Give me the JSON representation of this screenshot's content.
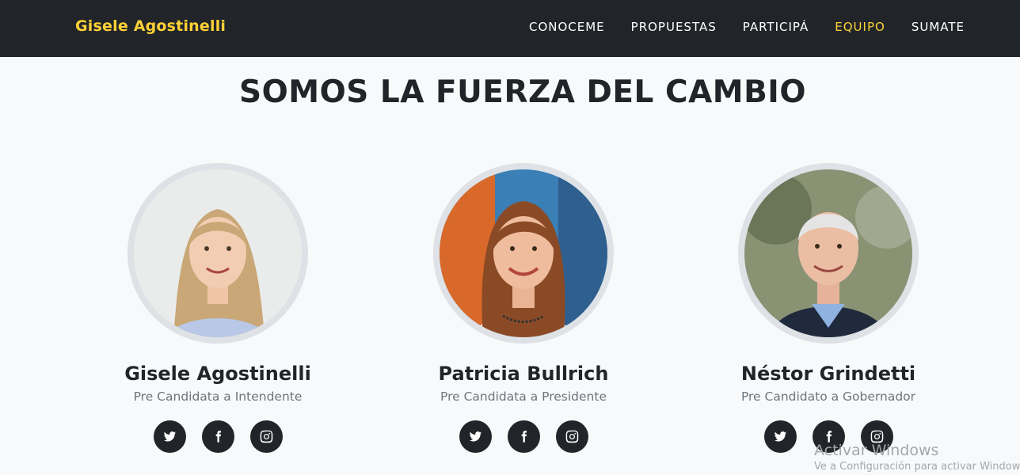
{
  "navbar": {
    "brand": "Gisele Agostinelli",
    "links": [
      {
        "label": "CONOCEME"
      },
      {
        "label": "PROPUESTAS"
      },
      {
        "label": "PARTICIPÁ"
      },
      {
        "label": "EQUIPO",
        "active": true
      },
      {
        "label": "SUMATE"
      }
    ]
  },
  "section": {
    "title": "SOMOS LA FUERZA DEL CAMBIO"
  },
  "team": [
    {
      "name": "Gisele Agostinelli",
      "role": "Pre Candidata a Intendente",
      "socials": [
        "twitter-icon",
        "facebook-icon",
        "instagram-icon"
      ]
    },
    {
      "name": "Patricia Bullrich",
      "role": "Pre Candidata a Presidente",
      "socials": [
        "twitter-icon",
        "facebook-icon",
        "instagram-icon"
      ]
    },
    {
      "name": "Néstor Grindetti",
      "role": "Pre Candidato a Gobernador",
      "socials": [
        "twitter-icon",
        "facebook-icon",
        "instagram-icon"
      ]
    }
  ],
  "watermark": {
    "line1": "Activar Windows",
    "line2": "Ve a Configuración para activar Windows."
  },
  "colors": {
    "navbar_bg": "#212529",
    "accent": "#fed136",
    "page_bg": "#f8f9fa",
    "text_dark": "#212529",
    "text_muted": "#6c757d"
  }
}
